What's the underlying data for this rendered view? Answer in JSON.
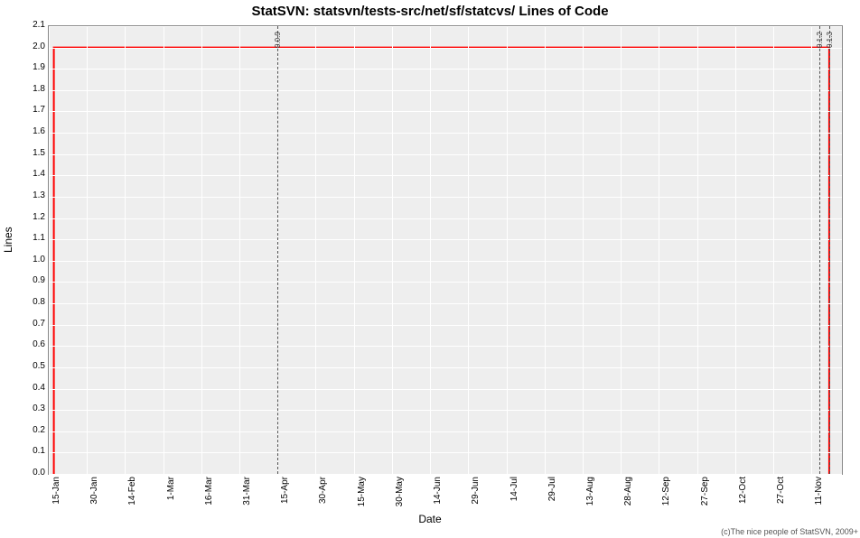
{
  "title": "StatSVN: statsvn/tests-src/net/sf/statcvs/ Lines of Code",
  "ylabel": "Lines",
  "xlabel": "Date",
  "credit": "(c)The nice people of StatSVN, 2009+",
  "chart_data": {
    "type": "line",
    "title": "StatSVN: statsvn/tests-src/net/sf/statcvs/ Lines of Code",
    "xlabel": "Date",
    "ylabel": "Lines",
    "ylim": [
      0.0,
      2.1
    ],
    "y_ticks": [
      0.0,
      0.1,
      0.2,
      0.3,
      0.4,
      0.5,
      0.6,
      0.7,
      0.8,
      0.9,
      1.0,
      1.1,
      1.2,
      1.3,
      1.4,
      1.5,
      1.6,
      1.7,
      1.8,
      1.9,
      2.0,
      2.1
    ],
    "x_categories": [
      "15-Jan",
      "30-Jan",
      "14-Feb",
      "1-Mar",
      "16-Mar",
      "31-Mar",
      "15-Apr",
      "30-Apr",
      "15-May",
      "30-May",
      "14-Jun",
      "29-Jun",
      "14-Jul",
      "29-Jul",
      "13-Aug",
      "28-Aug",
      "12-Sep",
      "27-Sep",
      "12-Oct",
      "27-Oct",
      "11-Nov"
    ],
    "series": [
      {
        "name": "Lines of Code",
        "color": "#ff0000",
        "points": [
          {
            "x": "17-Jan",
            "y": 0.0
          },
          {
            "x": "17-Jan",
            "y": 2.0
          },
          {
            "x": "18-Nov",
            "y": 2.0
          },
          {
            "x": "18-Nov",
            "y": 0.0
          }
        ]
      }
    ],
    "vertical_markers": [
      {
        "x": "15-Apr",
        "label": "0.0.9"
      },
      {
        "x": "14-Nov",
        "label": "0.1.2"
      },
      {
        "x": "18-Nov",
        "label": "0.1.3"
      }
    ]
  }
}
